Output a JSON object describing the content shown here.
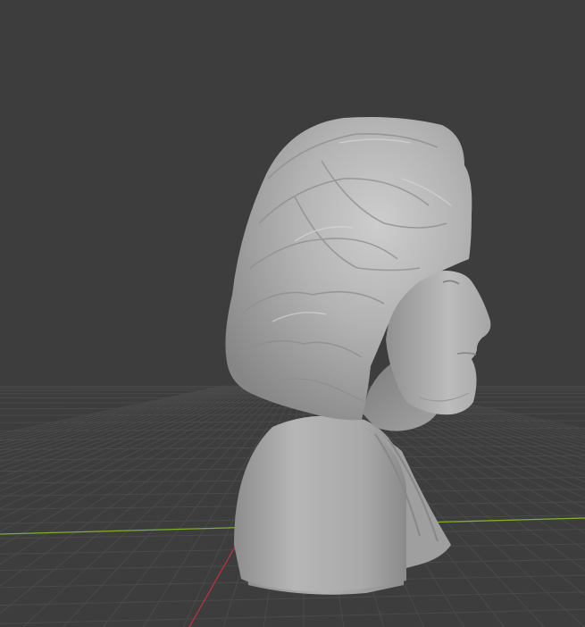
{
  "viewport": {
    "mode": "3d-viewport",
    "background_color": "#3d3d3d",
    "grid_line_color": "#4a4a4a",
    "x_axis_color": "#7fb02a",
    "y_axis_color": "#b8323f",
    "mesh_base_color": "#b4b4b4"
  },
  "scene": {
    "object_type": "sculpted-bust",
    "object_facing": "right-profile"
  }
}
